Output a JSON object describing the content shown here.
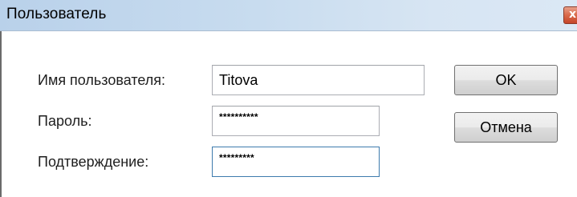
{
  "window": {
    "title": "Пользователь",
    "close_glyph": "x"
  },
  "form": {
    "username_label": "Имя пользователя:",
    "username_value": "Titova",
    "password_label": "Пароль:",
    "password_value": "**********",
    "confirm_label": "Подтверждение:",
    "confirm_value": "*********"
  },
  "buttons": {
    "ok_label": "OK",
    "cancel_label": "Отмена"
  },
  "colors": {
    "titlebar": "#c8dcef",
    "focus_border": "#3d7bad",
    "close_button": "#d9694a"
  }
}
